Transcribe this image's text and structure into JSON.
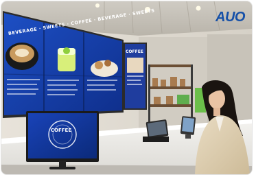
{
  "image": {
    "brand_logo": "AUO",
    "menu_banner": "BEVERAGE · SWEETS · COFFEE · BEVERAGE · SWEETS",
    "side_panel_heading": "COFFEE",
    "monitor_logo_text": "COFFEE"
  }
}
